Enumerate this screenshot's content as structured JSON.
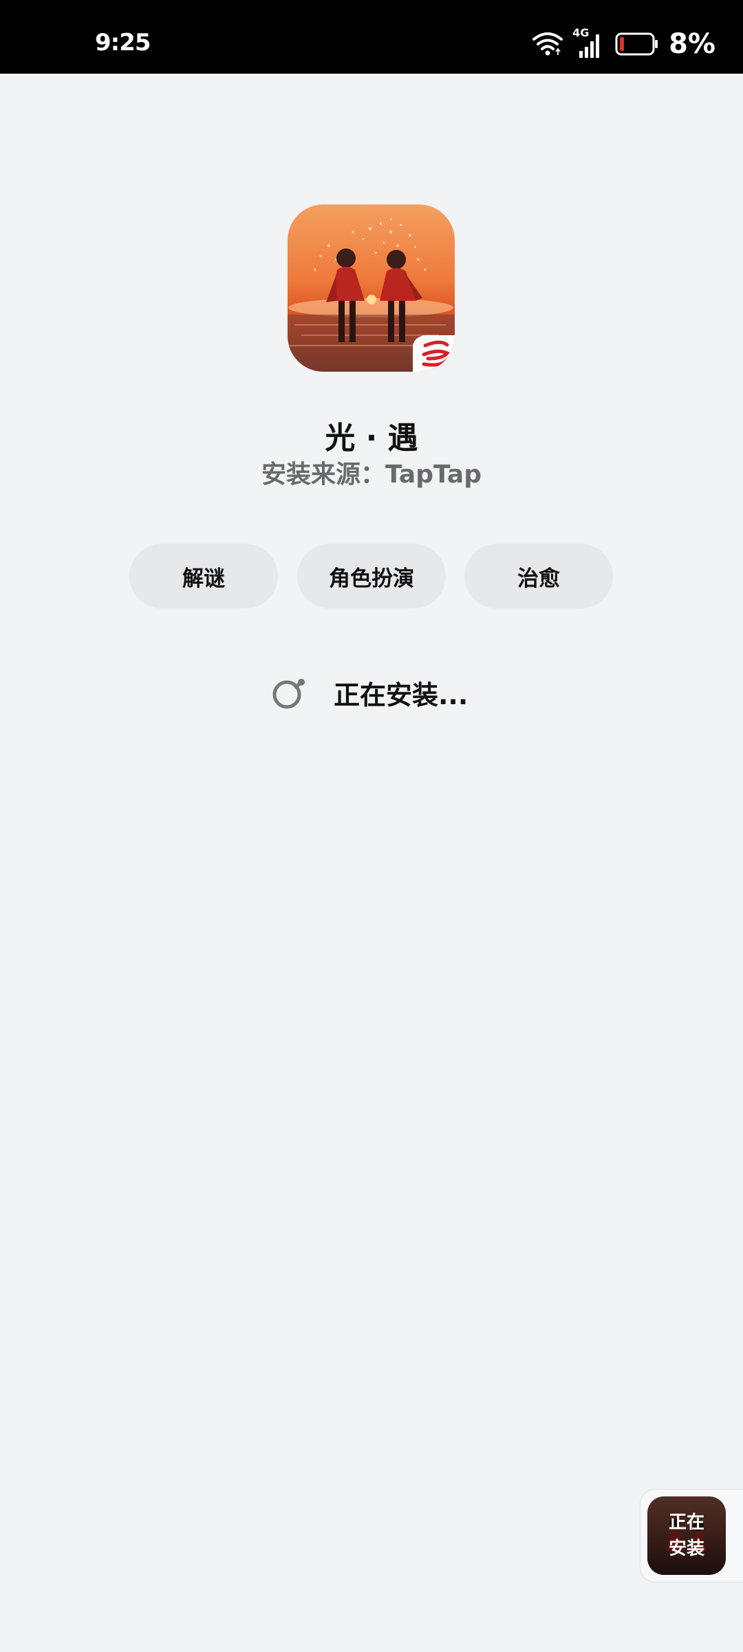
{
  "status_bar": {
    "time": "9:25",
    "network": "4G",
    "battery": "8%",
    "wifi_icon": "wifi-icon",
    "signal_icon": "cellular-signal-icon",
    "battery_icon": "battery-icon",
    "battery_level": 0.08,
    "battery_color": "#e0312b"
  },
  "app": {
    "name": "光 · 遇",
    "source": "安装来源：TapTap",
    "icon_name": "sky-game-app-icon",
    "publisher_badge": "netease-logo-icon"
  },
  "tags": [
    "解谜",
    "角色扮演",
    "治愈"
  ],
  "install": {
    "status_text": "正在安装...",
    "spinner_icon": "loading-spinner-icon"
  },
  "floating_widget": {
    "line1": "正在",
    "line2": "安装"
  },
  "colors": {
    "background": "#f2f3f5",
    "tag_background": "#e7e8ea",
    "title": "#111111",
    "subtitle": "#6a6a6a"
  }
}
